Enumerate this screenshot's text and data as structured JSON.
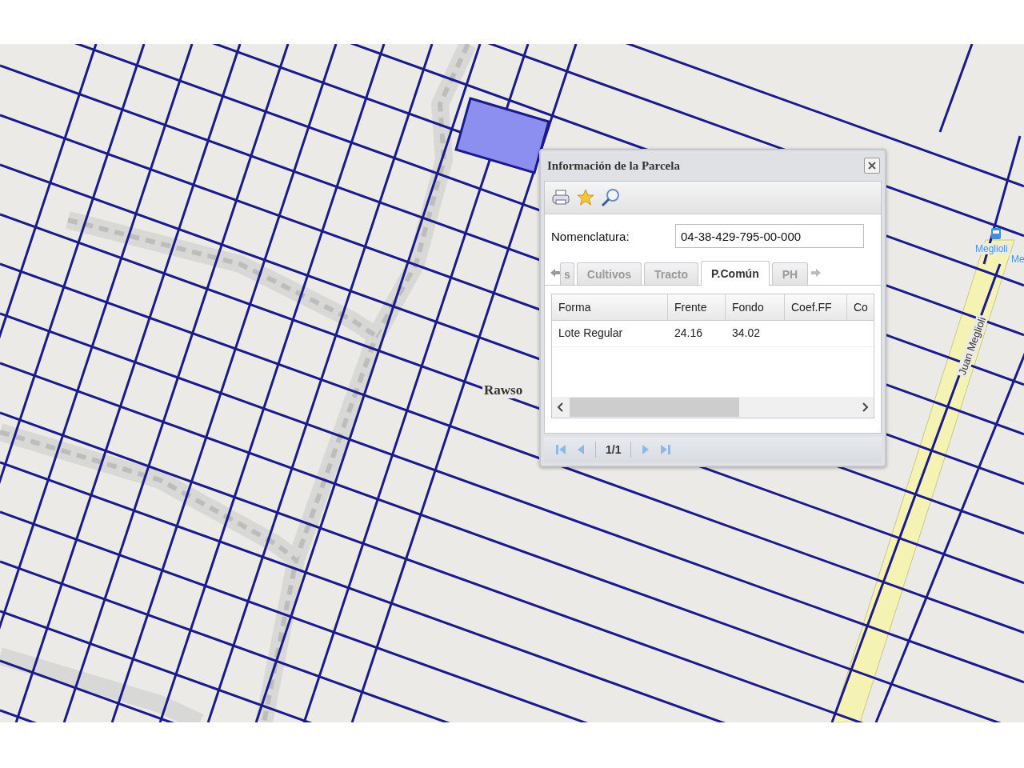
{
  "map": {
    "street_label": "Rawso",
    "road_label": "Juan Meglioli",
    "stop_label": [
      "Meglioli",
      "Me"
    ]
  },
  "popup": {
    "title": "Información de la Parcela",
    "field": {
      "label": "Nomenclatura:",
      "value": "04-38-429-795-00-000"
    },
    "tabs": [
      {
        "label": "s",
        "selected": false
      },
      {
        "label": "Cultivos",
        "selected": false
      },
      {
        "label": "Tracto",
        "selected": false
      },
      {
        "label": "P.Común",
        "selected": true
      },
      {
        "label": "PH",
        "selected": false
      }
    ],
    "table": {
      "columns": [
        "Forma",
        "Frente",
        "Fondo",
        "Coef.FF",
        "Co"
      ],
      "rows": [
        [
          "Lote Regular",
          "24.16",
          "34.02",
          "",
          ""
        ]
      ]
    },
    "pager": "1/1"
  }
}
